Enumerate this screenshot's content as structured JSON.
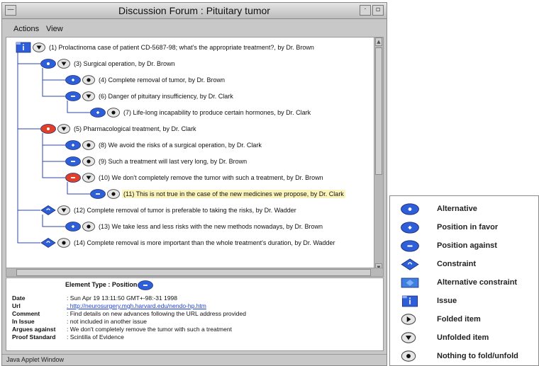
{
  "window": {
    "title": "Discussion Forum : Pituitary tumor",
    "menu": [
      "Actions",
      "View"
    ],
    "minimize_glyph": "—",
    "restore_glyph": "▫"
  },
  "tree": {
    "nodes": [
      {
        "depth": 0,
        "type": "issue",
        "state": "unfolded",
        "text": "(1)  Prolactinoma case of patient CD-5687-98; what's the appropriate treatment?, by Dr. Brown"
      },
      {
        "depth": 1,
        "type": "alternative",
        "state": "unfolded",
        "text": "(3)  Surgical operation, by Dr. Brown"
      },
      {
        "depth": 2,
        "type": "position-favor",
        "state": "none",
        "text": "(4)  Complete removal of tumor, by Dr. Brown"
      },
      {
        "depth": 2,
        "type": "position-against",
        "state": "unfolded",
        "text": "(6)  Danger of pituitary insufficiency, by Dr. Clark"
      },
      {
        "depth": 3,
        "type": "position-favor",
        "state": "none",
        "text": "(7)  Life-long incapability to produce certain hormones, by Dr. Clark"
      },
      {
        "depth": 1,
        "type": "alternative-red",
        "state": "unfolded",
        "text": "(5)  Pharmacological treatment, by Dr. Clark"
      },
      {
        "depth": 2,
        "type": "position-favor",
        "state": "none",
        "text": "(8)  We avoid the risks of a surgical operation, by Dr. Clark"
      },
      {
        "depth": 2,
        "type": "position-against",
        "state": "none",
        "text": "(9)  Such a treatment will last very long, by Dr. Brown"
      },
      {
        "depth": 2,
        "type": "position-against-red",
        "state": "unfolded",
        "text": "(10)  We don't completely remove the tumor with such a treatment, by Dr. Brown"
      },
      {
        "depth": 3,
        "type": "position-against",
        "state": "none",
        "text": "(11)  This is not true in the case of the new medicines we propose, by Dr. Clark",
        "highlight": true
      },
      {
        "depth": 1,
        "type": "constraint",
        "state": "unfolded",
        "text": "(12)  Complete removal of tumor is preferable to taking the risks, by Dr. Wadder"
      },
      {
        "depth": 2,
        "type": "position-favor",
        "state": "none",
        "text": "(13)  We take less and less risks with the new methods nowadays, by Dr. Brown"
      },
      {
        "depth": 1,
        "type": "constraint",
        "state": "none",
        "text": "(14)  Complete removal is more important than the whole treatment's duration, by Dr. Wadder"
      }
    ]
  },
  "detail": {
    "element_type_label": "Element Type : Position Con",
    "properties": [
      {
        "key": "Date",
        "value": ": Sun Apr 19 13:11:50 GMT+-98:-31 1998"
      },
      {
        "key": "Url",
        "value": ": http://neurosurgery.mgh.harvard.edu/nendo-hp.htm",
        "link": true
      },
      {
        "key": "Comment",
        "value": ": Find details on new advances following the URL address provided"
      },
      {
        "key": "In Issue",
        "value": ": not included in another issue"
      },
      {
        "key": "Argues against",
        "value": ": We don't completely remove the tumor with such a treatment"
      },
      {
        "key": "Proof Standard",
        "value": ": Scintilla of Evidence"
      }
    ]
  },
  "status_bar": "Java Applet Window",
  "legend": [
    {
      "icon": "alternative",
      "label": "Alternative"
    },
    {
      "icon": "position-favor",
      "label": "Position in favor"
    },
    {
      "icon": "position-against",
      "label": "Position against"
    },
    {
      "icon": "constraint",
      "label": "Constraint"
    },
    {
      "icon": "alternative-constraint",
      "label": "Alternative constraint"
    },
    {
      "icon": "issue",
      "label": "Issue"
    },
    {
      "icon": "folded",
      "label": "Folded item"
    },
    {
      "icon": "unfolded",
      "label": "Unfolded item"
    },
    {
      "icon": "none",
      "label": "Nothing to fold/unfold"
    }
  ],
  "colors": {
    "blue": "#2f5fd8",
    "red": "#e0402a",
    "highlight": "#fbf5bd",
    "link": "#1a3fd8",
    "tree_line": "#2a47a8"
  }
}
